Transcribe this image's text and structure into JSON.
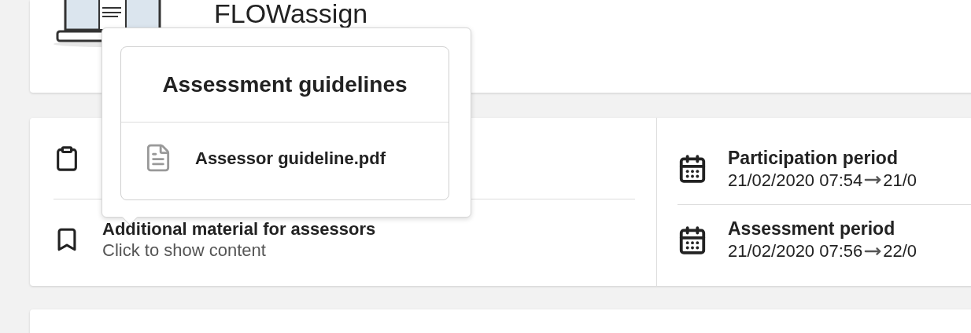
{
  "header": {
    "title": "FLOWassign"
  },
  "popover": {
    "title": "Assessment guidelines",
    "files": [
      {
        "name": "Assessor guideline.pdf"
      }
    ]
  },
  "materials": [
    {
      "kind": "clipboard"
    },
    {
      "kind": "bookmark",
      "title": "Additional material for assessors",
      "subtitle": "Click to show content"
    }
  ],
  "periods": [
    {
      "title": "Participation period",
      "start": "21/02/2020 07:54",
      "end": "21/0"
    },
    {
      "title": "Assessment period",
      "start": "21/02/2020 07:56",
      "end": "22/0"
    }
  ]
}
